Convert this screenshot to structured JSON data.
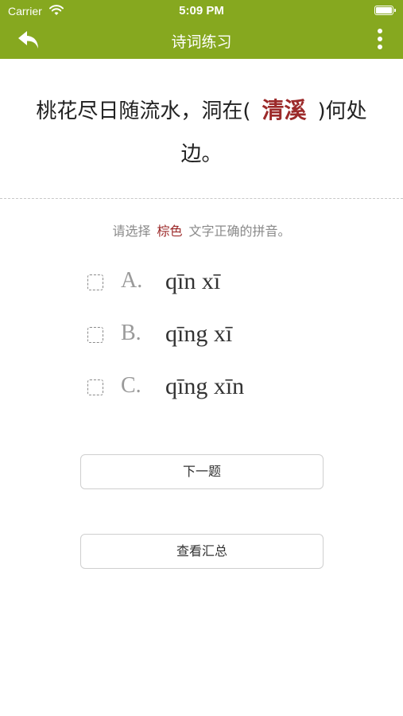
{
  "status_bar": {
    "carrier": "Carrier",
    "time": "5:09 PM"
  },
  "nav": {
    "title": "诗词练习"
  },
  "question": {
    "before": "桃花尽日随流水，洞在(",
    "answer": "清溪",
    "after": ")何处边。"
  },
  "prompt": {
    "before": "请选择",
    "highlight": "棕色",
    "after": "文字正确的拼音。"
  },
  "options": [
    {
      "letter": "A.",
      "text": "qīn xī"
    },
    {
      "letter": "B.",
      "text": "qīng xī"
    },
    {
      "letter": "C.",
      "text": "qīng xīn"
    }
  ],
  "buttons": {
    "next": "下一题",
    "summary": "查看汇总"
  },
  "colors": {
    "brand": "#86a81f",
    "highlight": "#9c2a2a"
  }
}
